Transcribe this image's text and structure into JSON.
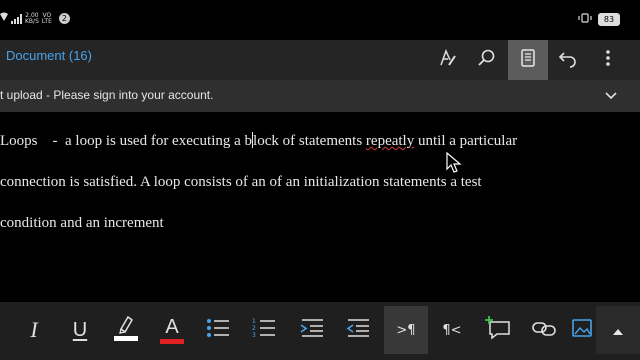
{
  "status_bar": {
    "net_label_top": "2.00",
    "net_label_bottom": "KB/S",
    "carrier_top": "VO",
    "carrier_bottom": "LTE",
    "notification_count": "2",
    "battery_level": "83"
  },
  "toolbar": {
    "document_title": "Document (16)",
    "icons": [
      "draw-icon",
      "search-icon",
      "reading-view-icon",
      "undo-icon",
      "more-icon"
    ]
  },
  "notice": {
    "text": "t upload - Please sign into your account."
  },
  "document": {
    "line1_before_caret": "Loops    -  a loop is used for executing a b",
    "line1_after_caret": "lock of statements ",
    "line1_misspelled": "repeatly",
    "line1_end": " until a particular",
    "line2": "connection is satisfied. A loop consists of an of an initialization statements a test",
    "line3": "condition and an increment"
  },
  "format_bar": {
    "italic_label": "I",
    "underline_label": "U",
    "font_color_label": "A",
    "ltr_label": ">¶",
    "rtl_label": "¶<",
    "highlight_color": "#ffffff",
    "font_color": "#e02020",
    "accent_color": "#4aa3ea"
  }
}
